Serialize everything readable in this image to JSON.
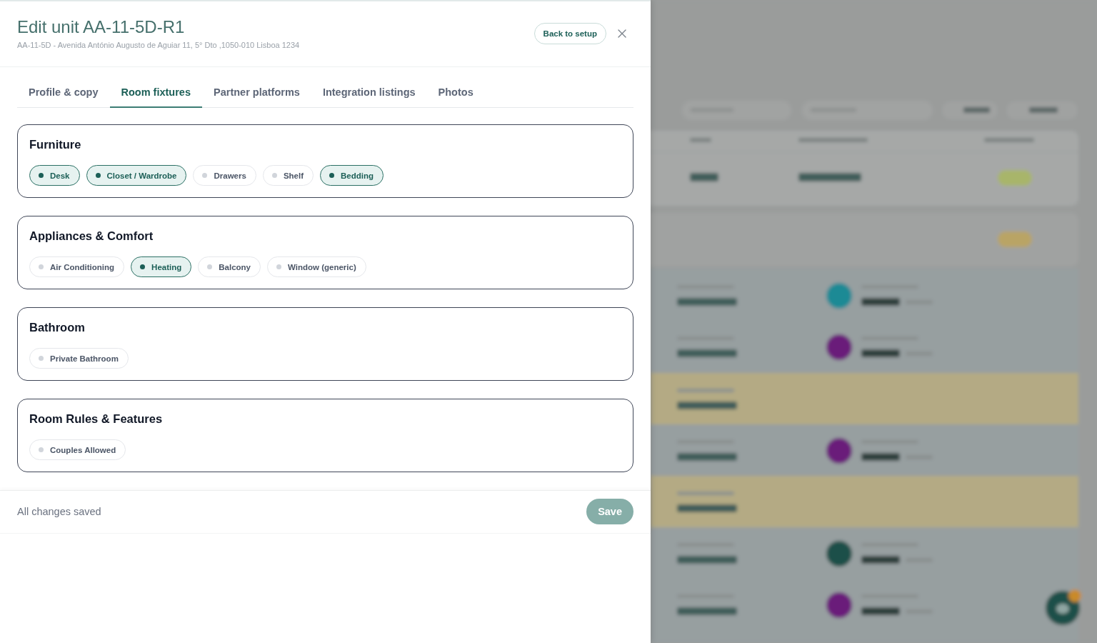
{
  "drawer": {
    "title": "Edit unit AA-11-5D-R1",
    "subtitle": "AA-11-5D - Avenida António Augusto de Aguiar 11, 5° Dto ,1050-010 Lisboa 1234",
    "back_button": "Back to setup",
    "tabs": [
      {
        "label": "Profile & copy",
        "selected": false
      },
      {
        "label": "Room fixtures",
        "selected": true
      },
      {
        "label": "Partner platforms",
        "selected": false
      },
      {
        "label": "Integration listings",
        "selected": false
      },
      {
        "label": "Photos",
        "selected": false
      }
    ],
    "sections": [
      {
        "title": "Furniture",
        "options": [
          {
            "label": "Desk",
            "selected": true
          },
          {
            "label": "Closet / Wardrobe",
            "selected": true
          },
          {
            "label": "Drawers",
            "selected": false
          },
          {
            "label": "Shelf",
            "selected": false
          },
          {
            "label": "Bedding",
            "selected": true
          }
        ]
      },
      {
        "title": "Appliances & Comfort",
        "options": [
          {
            "label": "Air Conditioning",
            "selected": false
          },
          {
            "label": "Heating",
            "selected": true
          },
          {
            "label": "Balcony",
            "selected": false
          },
          {
            "label": "Window (generic)",
            "selected": false
          }
        ]
      },
      {
        "title": "Bathroom",
        "options": [
          {
            "label": "Private Bathroom",
            "selected": false
          }
        ]
      },
      {
        "title": "Room Rules & Features",
        "options": [
          {
            "label": "Couples Allowed",
            "selected": false
          }
        ]
      }
    ],
    "footer": {
      "status": "All changes saved",
      "save_button": {
        "label": "Save",
        "disabled": true
      }
    }
  }
}
